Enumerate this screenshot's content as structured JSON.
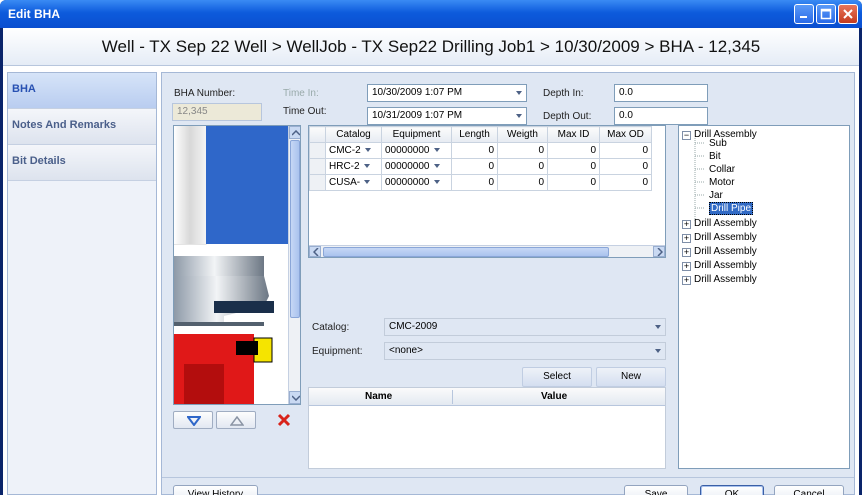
{
  "window": {
    "title": "Edit BHA"
  },
  "breadcrumb": "Well - TX Sep 22 Well > WellJob - TX Sep22 Drilling Job1 > 10/30/2009 > BHA - 12,345",
  "nav": [
    {
      "label": "BHA",
      "active": true
    },
    {
      "label": "Notes And Remarks",
      "active": false
    },
    {
      "label": "Bit Details",
      "active": false
    }
  ],
  "form": {
    "bha_number_label": "BHA Number:",
    "bha_number_value": "12,345",
    "time_in_label": "Time In:",
    "time_in_value": "10/30/2009  1:07 PM",
    "time_out_label": "Time Out:",
    "time_out_value": "10/31/2009  1:07 PM",
    "depth_in_label": "Depth In:",
    "depth_in_value": "0.0",
    "depth_out_label": "Depth Out:",
    "depth_out_value": "0.0"
  },
  "grid": {
    "headers": [
      "Catalog",
      "Equipment",
      "Length",
      "Weigth",
      "Max ID",
      "Max OD"
    ],
    "rows": [
      [
        "CMC-2",
        "00000000",
        "0",
        "0",
        "0",
        "0"
      ],
      [
        "HRC-2",
        "00000000",
        "0",
        "0",
        "0",
        "0"
      ],
      [
        "CUSA-",
        "00000000",
        "0",
        "0",
        "0",
        "0"
      ]
    ]
  },
  "tree": {
    "root": "Drill Assembly",
    "children": [
      "Sub",
      "Bit",
      "Collar",
      "Motor",
      "Jar",
      "Drill Pipe"
    ],
    "selected": "Drill Pipe",
    "siblings": [
      "Drill Assembly",
      "Drill Assembly",
      "Drill Assembly",
      "Drill Assembly",
      "Drill Assembly"
    ]
  },
  "detail": {
    "catalog_label": "Catalog:",
    "catalog_value": "CMC-2009",
    "equipment_label": "Equipment:",
    "equipment_value": "<none>",
    "select_label": "Select",
    "new_label": "New",
    "name_header": "Name",
    "value_header": "Value"
  },
  "footer": {
    "history_label": "View History",
    "save_label": "Save",
    "ok_label": "OK",
    "cancel_label": "Cancel"
  },
  "colors": {
    "title_bar": "#0d5bdc",
    "assembly_blue": "#2f67c9",
    "bit_red": "#e01818",
    "selection": "#316ac5"
  }
}
